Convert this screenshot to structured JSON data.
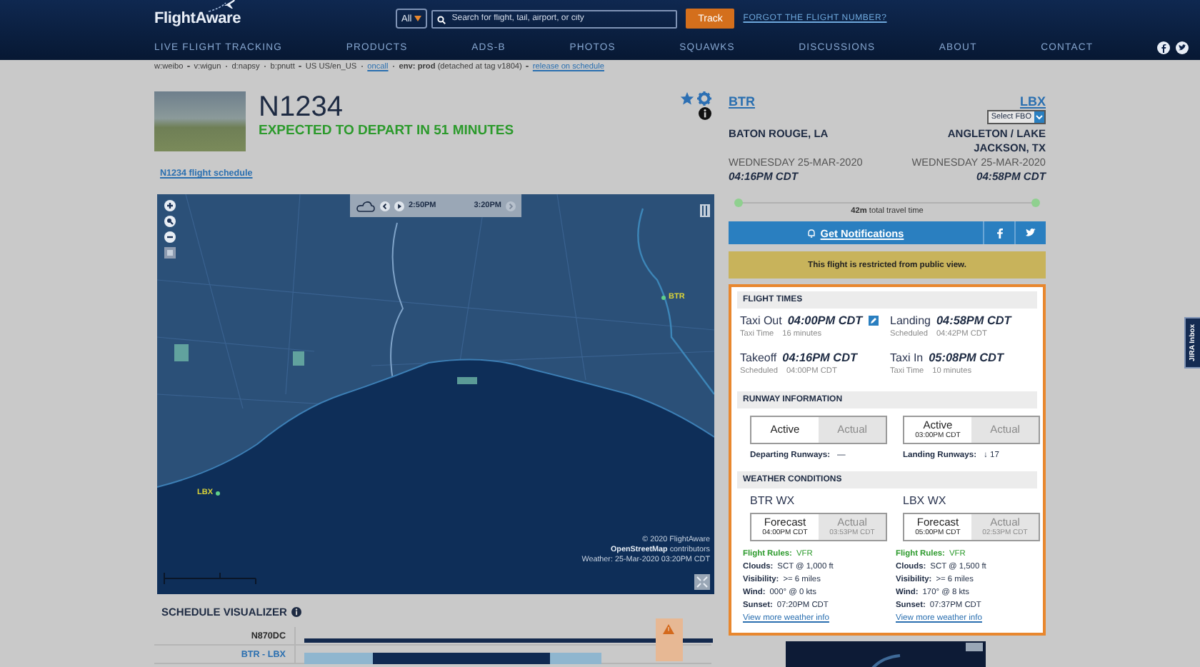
{
  "header": {
    "logo": "FlightAware",
    "search_scope": "All",
    "search": {
      "placeholder": "Search for flight, tail, airport, or city"
    },
    "track_button": "Track",
    "forgot_link": "FORGOT THE FLIGHT NUMBER?",
    "nav": [
      "LIVE FLIGHT TRACKING",
      "PRODUCTS",
      "ADS-B",
      "PHOTOS",
      "SQUAWKS",
      "DISCUSSIONS",
      "ABOUT",
      "CONTACT"
    ]
  },
  "dev_bar": [
    {
      "kind": "text",
      "text": "w:weibo"
    },
    {
      "kind": "text",
      "text": "v:wigun"
    },
    {
      "kind": "text",
      "text": "d:napsy"
    },
    {
      "kind": "text",
      "text": "b:pnutt"
    },
    {
      "kind": "text",
      "text": "US US/en_US"
    },
    {
      "kind": "link",
      "text": "oncall"
    },
    {
      "kind": "text",
      "text": "**env: prod** (detached at tag v1804)"
    },
    {
      "kind": "link",
      "text": "release on schedule"
    }
  ],
  "flight": {
    "ident": "N1234",
    "status": "EXPECTED TO DEPART IN 51 MINUTES",
    "schedule_link": "N1234 flight schedule"
  },
  "map": {
    "weather_times": [
      "2:50PM",
      "3:20PM"
    ],
    "airports": [
      {
        "code": "BTR"
      },
      {
        "code": "LBX"
      }
    ],
    "attribution": [
      "© 2020 FlightAware",
      "**OpenStreetMap** contributors",
      "Weather: 25-Mar-2020 03:20PM CDT"
    ]
  },
  "route": {
    "origin": {
      "code": "BTR",
      "city": "BATON ROUGE, LA",
      "date": "WEDNESDAY 25-MAR-2020",
      "time": "04:16PM CDT"
    },
    "destination": {
      "code": "LBX",
      "city": "ANGLETON / LAKE JACKSON, TX",
      "date": "WEDNESDAY 25-MAR-2020",
      "time": "04:58PM CDT"
    },
    "fbo_select": "Select FBO",
    "travel_time": "**42m** total travel time"
  },
  "notifications_button": "Get Notifications",
  "restricted_notice": "This flight is restricted from public view.",
  "flight_times": {
    "title": "FLIGHT TIMES",
    "items": [
      {
        "label": "Taxi Out",
        "time": "04:00PM CDT",
        "sub_label": "Taxi Time",
        "sub_value": "16 minutes",
        "edit": true
      },
      {
        "label": "Landing",
        "time": "04:58PM CDT",
        "sub_label": "Scheduled",
        "sub_value": "04:42PM CDT",
        "edit": false
      },
      {
        "label": "Takeoff",
        "time": "04:16PM CDT",
        "sub_label": "Scheduled",
        "sub_value": "04:00PM CDT",
        "edit": false
      },
      {
        "label": "Taxi In",
        "time": "05:08PM CDT",
        "sub_label": "Taxi Time",
        "sub_value": "10 minutes",
        "edit": false
      }
    ]
  },
  "runway": {
    "title": "RUNWAY INFORMATION",
    "sides": [
      {
        "tabs": [
          {
            "label": "Active",
            "selected": true
          },
          {
            "label": "Actual",
            "selected": false
          }
        ],
        "label": "Departing Runways:",
        "value": "—"
      },
      {
        "tabs": [
          {
            "label": "Active",
            "sub": "03:00PM CDT",
            "selected": true
          },
          {
            "label": "Actual",
            "selected": false
          }
        ],
        "label": "Landing Runways:",
        "value": "↓ 17"
      }
    ]
  },
  "weather": {
    "title": "WEATHER CONDITIONS",
    "stations": [
      {
        "name": "BTR WX",
        "tabs": [
          {
            "label": "Forecast",
            "sub": "04:00PM CDT",
            "selected": true
          },
          {
            "label": "Actual",
            "sub": "03:53PM CDT",
            "selected": false
          }
        ],
        "rows": [
          {
            "kind": "rules",
            "label": "Flight Rules:",
            "value": "VFR"
          },
          {
            "kind": "plain",
            "label": "Clouds:",
            "value": "SCT @ 1,000 ft"
          },
          {
            "kind": "plain",
            "label": "Visibility:",
            "value": ">= 6 miles"
          },
          {
            "kind": "plain",
            "label": "Wind:",
            "value": "000° @ 0 kts"
          },
          {
            "kind": "plain",
            "label": "Sunset:",
            "value": "07:20PM CDT"
          }
        ],
        "link": "View more weather info"
      },
      {
        "name": "LBX WX",
        "tabs": [
          {
            "label": "Forecast",
            "sub": "05:00PM CDT",
            "selected": true
          },
          {
            "label": "Actual",
            "sub": "02:53PM CDT",
            "selected": false
          }
        ],
        "rows": [
          {
            "kind": "rules",
            "label": "Flight Rules:",
            "value": "VFR"
          },
          {
            "kind": "plain",
            "label": "Clouds:",
            "value": "SCT @ 1,500 ft"
          },
          {
            "kind": "plain",
            "label": "Visibility:",
            "value": ">= 6 miles"
          },
          {
            "kind": "plain",
            "label": "Wind:",
            "value": "170° @ 8 kts"
          },
          {
            "kind": "plain",
            "label": "Sunset:",
            "value": "07:37PM CDT"
          }
        ],
        "link": "View more weather info"
      }
    ]
  },
  "schedule_visualizer": {
    "title": "SCHEDULE VISUALIZER",
    "rows": [
      {
        "label": "N870DC",
        "kind": "aircraft"
      },
      {
        "label": "BTR - LBX",
        "kind": "route"
      }
    ]
  },
  "jira_tab": "JIRA Inbox"
}
